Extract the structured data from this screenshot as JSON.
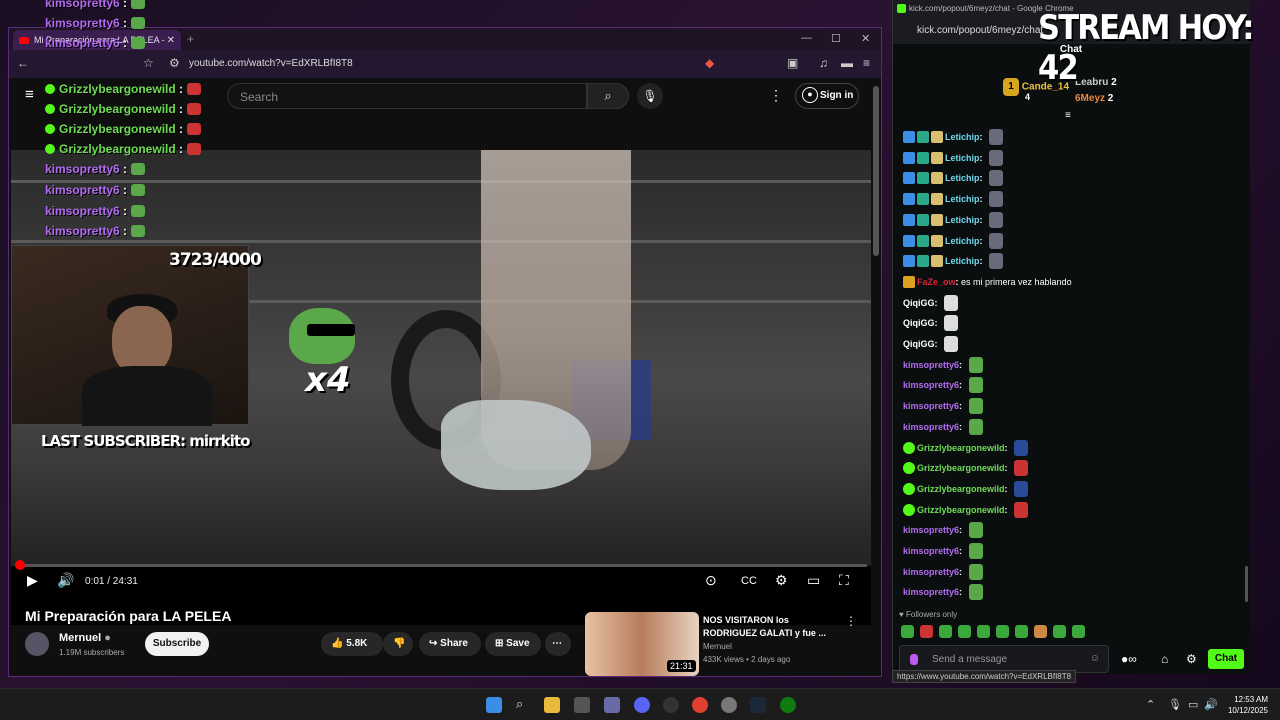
{
  "youtube": {
    "tab_title": "Mi Preparación para LA PELEA -",
    "url": "youtube.com/watch?v=EdXRLBfI8T8",
    "search_placeholder": "Search",
    "sign_in": "Sign in",
    "overlay": {
      "goal": "3723/4000",
      "multiplier": "x4",
      "last_subscriber": "LAST SUBSCRIBER: mirrkito"
    },
    "player": {
      "time": "0:01 / 24:31",
      "progress": 0.001
    },
    "video_title": "Mi Preparación para LA PELEA",
    "channel": "Mernuel",
    "subscribers": "1.19M subscribers",
    "subscribe": "Subscribe",
    "likes": "5.8K",
    "share": "Share",
    "save": "Save",
    "recommended": {
      "title": "NOS VISITARON los RODRIGUEZ GALATI y fue ...",
      "channel": "Mernuel",
      "meta": "433K views • 2 days ago",
      "duration": "21:31"
    }
  },
  "stream_chat_overlay": [
    {
      "user": "kimsopretty6",
      "color": "purple",
      "verified": false
    },
    {
      "user": "kimsopretty6",
      "color": "purple",
      "verified": false
    },
    {
      "user": "kimsopretty6",
      "color": "purple",
      "verified": false
    },
    {
      "user": "Grizzlybeargonewild",
      "color": "green",
      "verified": true
    },
    {
      "user": "Grizzlybeargonewild",
      "color": "green",
      "verified": true
    },
    {
      "user": "Grizzlybeargonewild",
      "color": "green",
      "verified": true
    },
    {
      "user": "Grizzlybeargonewild",
      "color": "green",
      "verified": true
    },
    {
      "user": "kimsopretty6",
      "color": "purple",
      "verified": false
    },
    {
      "user": "kimsopretty6",
      "color": "purple",
      "verified": false
    },
    {
      "user": "kimsopretty6",
      "color": "purple",
      "verified": false
    },
    {
      "user": "kimsopretty6",
      "color": "purple",
      "verified": false
    }
  ],
  "kick": {
    "window_title": "kick.com/popout/6meyz/chat - Google Chrome",
    "address": "kick.com/popout/6meyz/chat",
    "tab": "Chat",
    "stream_banner": "STREAM HOY: 42",
    "top_gifters": [
      {
        "rank": "1",
        "name": "Cande_14",
        "count": "4"
      },
      {
        "rank": "",
        "name": "Leabru",
        "count": "2"
      },
      {
        "rank": "",
        "name": "6Meyz",
        "count": "2"
      }
    ],
    "messages": [
      {
        "user": "Letichip",
        "text": "",
        "color": "#6fd8f0"
      },
      {
        "user": "Letichip",
        "text": "",
        "color": "#6fd8f0"
      },
      {
        "user": "Letichip",
        "text": "",
        "color": "#6fd8f0"
      },
      {
        "user": "Letichip",
        "text": "",
        "color": "#6fd8f0"
      },
      {
        "user": "Letichip",
        "text": "",
        "color": "#6fd8f0"
      },
      {
        "user": "Letichip",
        "text": "",
        "color": "#6fd8f0"
      },
      {
        "user": "Letichip",
        "text": "",
        "color": "#6fd8f0"
      },
      {
        "user": "FaZe_ow",
        "text": "es mi primera vez hablando",
        "color": "#e0213a"
      },
      {
        "user": "QiqiGG",
        "text": "",
        "color": "#ffffff"
      },
      {
        "user": "QiqiGG",
        "text": "",
        "color": "#ffffff"
      },
      {
        "user": "QiqiGG",
        "text": "",
        "color": "#ffffff"
      },
      {
        "user": "kimsopretty6",
        "text": "",
        "color": "#b26bf0"
      },
      {
        "user": "kimsopretty6",
        "text": "",
        "color": "#b26bf0"
      },
      {
        "user": "kimsopretty6",
        "text": "",
        "color": "#b26bf0"
      },
      {
        "user": "kimsopretty6",
        "text": "",
        "color": "#b26bf0"
      },
      {
        "user": "Grizzlybeargonewild",
        "text": "",
        "color": "#6fdc55"
      },
      {
        "user": "Grizzlybeargonewild",
        "text": "",
        "color": "#6fdc55"
      },
      {
        "user": "Grizzlybeargonewild",
        "text": "",
        "color": "#6fdc55"
      },
      {
        "user": "Grizzlybeargonewild",
        "text": "",
        "color": "#6fdc55"
      },
      {
        "user": "kimsopretty6",
        "text": "",
        "color": "#b26bf0"
      },
      {
        "user": "kimsopretty6",
        "text": "",
        "color": "#b26bf0"
      },
      {
        "user": "kimsopretty6",
        "text": "",
        "color": "#b26bf0"
      },
      {
        "user": "kimsopretty6",
        "text": "",
        "color": "#b26bf0"
      }
    ],
    "followers_only": "Followers only",
    "send_placeholder": "Send a message",
    "chat_button": "Chat",
    "hover_url": "https://www.youtube.com/watch?v=EdXRLBfI8T8"
  },
  "taskbar": {
    "time": "12:53 AM",
    "date": "10/12/2025"
  }
}
